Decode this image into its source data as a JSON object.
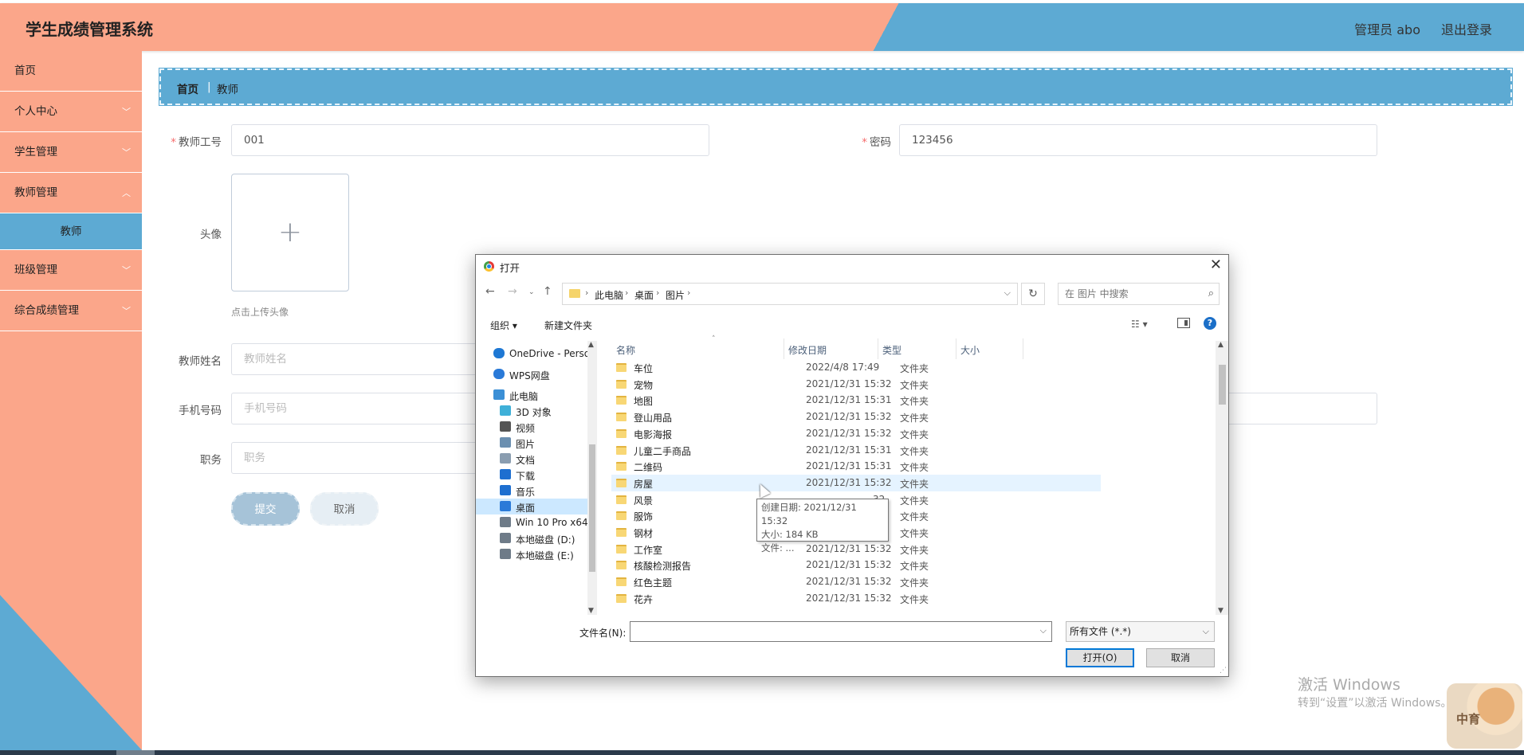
{
  "app": {
    "title": "学生成绩管理系统",
    "user": "管理员 abo",
    "logout": "退出登录",
    "colors": {
      "peach": "#fba68a",
      "blue": "#5daad3"
    }
  },
  "sidebar": {
    "items": [
      {
        "label": "首页",
        "has_arrow": false
      },
      {
        "label": "个人中心",
        "has_arrow": true
      },
      {
        "label": "学生管理",
        "has_arrow": true
      },
      {
        "label": "教师管理",
        "has_arrow": true
      },
      {
        "label": "教师",
        "sub": true
      },
      {
        "label": "班级管理",
        "has_arrow": true
      },
      {
        "label": "综合成绩管理",
        "has_arrow": true
      }
    ]
  },
  "breadcrumb": {
    "home": "首页",
    "sep": "|",
    "current": "教师"
  },
  "form": {
    "teacher_no_label": "教师工号",
    "teacher_no_value": "001",
    "password_label": "密码",
    "password_value": "123456",
    "avatar_label": "头像",
    "avatar_plus": "+",
    "avatar_hint": "点击上传头像",
    "name_label": "教师姓名",
    "name_placeholder": "教师姓名",
    "phone_label": "手机号码",
    "phone_placeholder": "手机号码",
    "position_label": "职务",
    "position_placeholder": "职务",
    "submit": "提交",
    "cancel": "取消"
  },
  "dialog": {
    "title": "打开",
    "close": "✕",
    "path": [
      "此电脑",
      "桌面",
      "图片"
    ],
    "search_placeholder": "在 图片 中搜索",
    "organize": "组织 ▾",
    "new_folder": "新建文件夹",
    "tree": [
      {
        "label": "OneDrive - Perso",
        "icon": "onedrive-icon"
      },
      {
        "label": "WPS网盘",
        "icon": "cloud-icon"
      },
      {
        "label": "此电脑",
        "icon": "computer-icon"
      },
      {
        "label": "3D 对象",
        "icon": "cube-icon"
      },
      {
        "label": "视频",
        "icon": "video-icon"
      },
      {
        "label": "图片",
        "icon": "picture-icon"
      },
      {
        "label": "文档",
        "icon": "document-icon"
      },
      {
        "label": "下载",
        "icon": "download-icon"
      },
      {
        "label": "音乐",
        "icon": "music-icon"
      },
      {
        "label": "桌面",
        "icon": "desktop-icon",
        "selected": true
      },
      {
        "label": "Win 10 Pro x64",
        "icon": "drive-icon"
      },
      {
        "label": "本地磁盘 (D:)",
        "icon": "drive-icon"
      },
      {
        "label": "本地磁盘 (E:)",
        "icon": "drive-icon"
      }
    ],
    "columns": [
      "名称",
      "修改日期",
      "类型",
      "大小"
    ],
    "rows": [
      {
        "name": "车位",
        "date": "2022/4/8 17:49",
        "type": "文件夹"
      },
      {
        "name": "宠物",
        "date": "2021/12/31 15:32",
        "type": "文件夹"
      },
      {
        "name": "地图",
        "date": "2021/12/31 15:31",
        "type": "文件夹"
      },
      {
        "name": "登山用品",
        "date": "2021/12/31 15:32",
        "type": "文件夹"
      },
      {
        "name": "电影海报",
        "date": "2021/12/31 15:32",
        "type": "文件夹"
      },
      {
        "name": "儿童二手商品",
        "date": "2021/12/31 15:31",
        "type": "文件夹"
      },
      {
        "name": "二维码",
        "date": "2021/12/31 15:31",
        "type": "文件夹"
      },
      {
        "name": "房屋",
        "date": "2021/12/31 15:32",
        "type": "文件夹",
        "hover": true
      },
      {
        "name": "风景",
        "date": "32",
        "type": "文件夹"
      },
      {
        "name": "服饰",
        "date": "32",
        "type": "文件夹"
      },
      {
        "name": "钢材",
        "date": "7",
        "type": "文件夹"
      },
      {
        "name": "工作室",
        "date": "2021/12/31 15:32",
        "type": "文件夹"
      },
      {
        "name": "核酸检测报告",
        "date": "2021/12/31 15:32",
        "type": "文件夹"
      },
      {
        "name": "红色主题",
        "date": "2021/12/31 15:32",
        "type": "文件夹"
      },
      {
        "name": "花卉",
        "date": "2021/12/31 15:32",
        "type": "文件夹"
      }
    ],
    "tooltip": [
      "创建日期: 2021/12/31 15:32",
      "大小: 184 KB",
      "文件: ..."
    ],
    "filename_label": "文件名(N):",
    "filename_value": "",
    "filetype": "所有文件 (*.*)",
    "open": "打开(O)",
    "cancel": "取消"
  },
  "watermark": {
    "line1": "激活 Windows",
    "line2": "转到“设置”以激活 Windows。",
    "badge": "中育"
  }
}
